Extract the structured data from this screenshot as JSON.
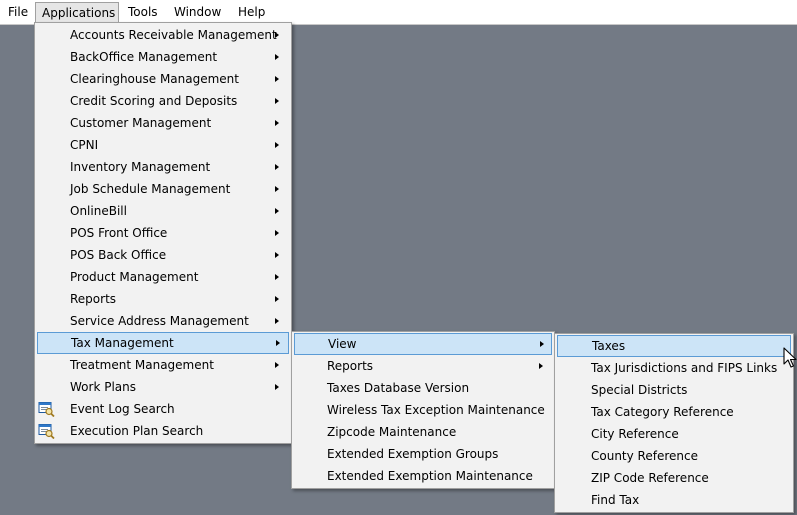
{
  "menubar": {
    "items": [
      {
        "label": "File",
        "key": "file"
      },
      {
        "label": "Applications",
        "key": "applications"
      },
      {
        "label": "Tools",
        "key": "tools"
      },
      {
        "label": "Window",
        "key": "window"
      },
      {
        "label": "Help",
        "key": "help"
      }
    ]
  },
  "applications_menu": {
    "items": [
      {
        "label": "Accounts Receivable Management",
        "submenu": true
      },
      {
        "label": "BackOffice Management",
        "submenu": true
      },
      {
        "label": "Clearinghouse Management",
        "submenu": true
      },
      {
        "label": "Credit Scoring and Deposits",
        "submenu": true
      },
      {
        "label": "Customer Management",
        "submenu": true
      },
      {
        "label": "CPNI",
        "submenu": true
      },
      {
        "label": "Inventory Management",
        "submenu": true
      },
      {
        "label": "Job Schedule Management",
        "submenu": true
      },
      {
        "label": "OnlineBill",
        "submenu": true
      },
      {
        "label": "POS Front Office",
        "submenu": true
      },
      {
        "label": "POS Back Office",
        "submenu": true
      },
      {
        "label": "Product Management",
        "submenu": true
      },
      {
        "label": "Reports",
        "submenu": true
      },
      {
        "label": "Service Address Management",
        "submenu": true
      },
      {
        "label": "Tax Management",
        "submenu": true,
        "selected": true
      },
      {
        "label": "Treatment Management",
        "submenu": true
      },
      {
        "label": "Work Plans",
        "submenu": true
      },
      {
        "label": "Event Log Search",
        "icon": "search-window-icon"
      },
      {
        "label": "Execution Plan Search",
        "icon": "search-window-icon"
      }
    ]
  },
  "tax_management_menu": {
    "items": [
      {
        "label": "View",
        "submenu": true,
        "selected": true
      },
      {
        "label": "Reports",
        "submenu": true
      },
      {
        "label": "Taxes Database Version"
      },
      {
        "label": "Wireless Tax Exception Maintenance"
      },
      {
        "label": "Zipcode Maintenance"
      },
      {
        "label": "Extended Exemption Groups"
      },
      {
        "label": "Extended Exemption Maintenance"
      }
    ]
  },
  "view_menu": {
    "items": [
      {
        "label": "Taxes",
        "selected": true
      },
      {
        "label": "Tax Jurisdictions and FIPS Links"
      },
      {
        "label": "Special Districts"
      },
      {
        "label": "Tax Category Reference"
      },
      {
        "label": "City Reference"
      },
      {
        "label": "County Reference"
      },
      {
        "label": "ZIP Code Reference"
      },
      {
        "label": "Find Tax"
      }
    ]
  },
  "colors": {
    "desktop": "#737a85",
    "menu_bg": "#f2f2f2",
    "highlight_bg": "#cce4f7",
    "highlight_border": "#5b9bd5"
  },
  "cursor": "arrow-cursor-icon"
}
